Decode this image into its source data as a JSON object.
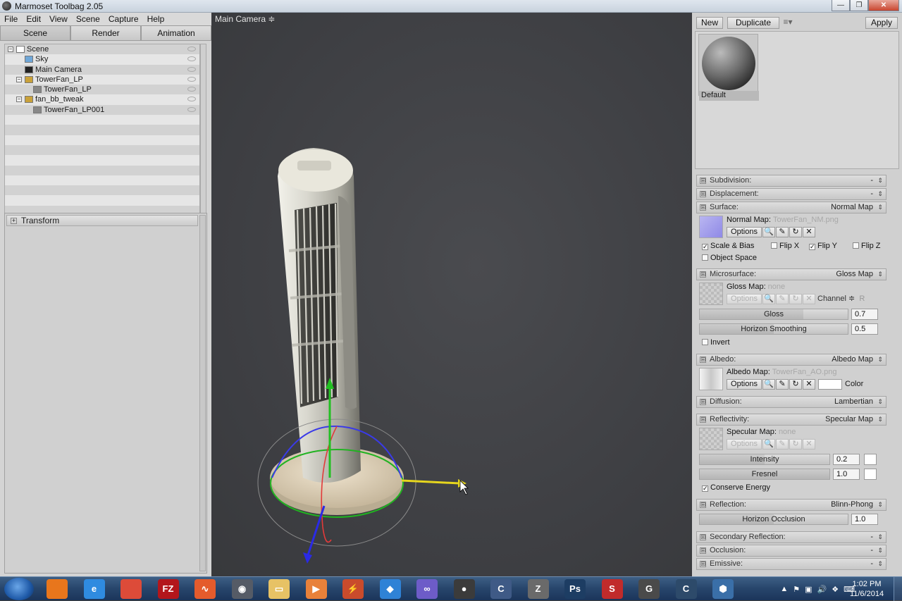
{
  "window": {
    "title": "Marmoset Toolbag 2.05",
    "minimize": "—",
    "maximize": "❐",
    "close": "✕"
  },
  "menu": [
    "File",
    "Edit",
    "View",
    "Scene",
    "Capture",
    "Help"
  ],
  "left_tabs": [
    "Scene",
    "Render",
    "Animation"
  ],
  "scene_tree": [
    {
      "label": "Scene",
      "indent": 0,
      "icon": "scene-icon",
      "expander": "−"
    },
    {
      "label": "Sky",
      "indent": 1,
      "icon": "sky-icon"
    },
    {
      "label": "Main Camera",
      "indent": 1,
      "icon": "camera-icon"
    },
    {
      "label": "TowerFan_LP",
      "indent": 1,
      "icon": "transform-icon",
      "expander": "−"
    },
    {
      "label": "TowerFan_LP",
      "indent": 2,
      "icon": "mesh-icon"
    },
    {
      "label": "fan_bb_tweak",
      "indent": 1,
      "icon": "transform-icon",
      "expander": "−"
    },
    {
      "label": "TowerFan_LP001",
      "indent": 2,
      "icon": "mesh-icon"
    }
  ],
  "transform": {
    "label": "Transform",
    "expander": "+"
  },
  "viewport": {
    "camera_label": "Main Camera ≑"
  },
  "material_bar": {
    "new": "New",
    "duplicate": "Duplicate",
    "menu": "≡▾",
    "apply": "Apply"
  },
  "material": {
    "name": "Default"
  },
  "sections": {
    "subdivision": {
      "name": "Subdivision:",
      "value": "-"
    },
    "displacement": {
      "name": "Displacement:",
      "value": "-"
    },
    "surface": {
      "name": "Surface:",
      "value": "Normal Map"
    },
    "microsurface": {
      "name": "Microsurface:",
      "value": "Gloss Map"
    },
    "albedo": {
      "name": "Albedo:",
      "value": "Albedo Map"
    },
    "diffusion": {
      "name": "Diffusion:",
      "value": "Lambertian"
    },
    "reflectivity": {
      "name": "Reflectivity:",
      "value": "Specular Map"
    },
    "reflection": {
      "name": "Reflection:",
      "value": "Blinn-Phong"
    },
    "secondary_reflection": {
      "name": "Secondary Reflection:",
      "value": "-"
    },
    "occlusion": {
      "name": "Occlusion:",
      "value": "-"
    },
    "emissive": {
      "name": "Emissive:",
      "value": "-"
    }
  },
  "section_plus": "⊞",
  "section_arrow": "⇕",
  "surface": {
    "map_label": "Normal Map:",
    "map_file": "TowerFan_NM.png",
    "options": "Options",
    "scale_bias": "Scale & Bias",
    "flip_x": "Flip X",
    "flip_y": "Flip Y",
    "flip_z": "Flip Z",
    "object_space": "Object Space"
  },
  "microsurface": {
    "map_label": "Gloss Map:",
    "map_file": "none",
    "options": "Options",
    "channel_label": "Channel ≑",
    "channel_value": "R",
    "gloss_label": "Gloss",
    "gloss_value": "0.7",
    "gloss_fraction": 0.7,
    "horizon_label": "Horizon Smoothing",
    "horizon_value": "0.5",
    "horizon_fraction": 0.5,
    "invert": "Invert"
  },
  "albedo": {
    "map_label": "Albedo Map:",
    "map_file": "TowerFan_AO.png",
    "options": "Options",
    "color_label": "Color",
    "color_hex": "#ffffff"
  },
  "reflectivity": {
    "map_label": "Specular Map:",
    "map_file": "none",
    "options": "Options",
    "intensity_label": "Intensity",
    "intensity_value": "0.2",
    "intensity_fraction": 0.5,
    "fresnel_label": "Fresnel",
    "fresnel_value": "1.0",
    "fresnel_fraction": 1.0,
    "conserve_energy": "Conserve Energy"
  },
  "reflection": {
    "occlusion_label": "Horizon Occlusion",
    "occlusion_value": "1.0",
    "occlusion_fraction": 0.5
  },
  "glyphs": {
    "check": "✓",
    "search": "🔍",
    "pencil": "✎",
    "reload": "↻",
    "clear": "✕"
  },
  "taskbar": {
    "apps": [
      {
        "name": "firefox-icon",
        "glyph": "",
        "color": "#e8761c"
      },
      {
        "name": "internet-explorer-icon",
        "glyph": "e",
        "color": "#2f8be0"
      },
      {
        "name": "chrome-icon",
        "glyph": "",
        "color": "#dd4b39"
      },
      {
        "name": "filezilla-icon",
        "glyph": "FZ",
        "color": "#b3161b"
      },
      {
        "name": "app-swirl-icon",
        "glyph": "∿",
        "color": "#e45b2c"
      },
      {
        "name": "marmoset-icon",
        "glyph": "◉",
        "color": "#555b66"
      },
      {
        "name": "explorer-folder-icon",
        "glyph": "▭",
        "color": "#e7c265"
      },
      {
        "name": "media-player-icon",
        "glyph": "▶",
        "color": "#e8813a"
      },
      {
        "name": "xsi-icon",
        "glyph": "⚡",
        "color": "#c94b2c"
      },
      {
        "name": "dropbox-icon",
        "glyph": "◆",
        "color": "#2f82d6"
      },
      {
        "name": "app-purple-icon",
        "glyph": "∞",
        "color": "#6d5cc8"
      },
      {
        "name": "marmoset-active-icon",
        "glyph": "●",
        "color": "#3b3b3b"
      },
      {
        "name": "app-c-icon",
        "glyph": "C",
        "color": "#3f5a86"
      },
      {
        "name": "zbrush-icon",
        "glyph": "Z",
        "color": "#6a6a6a"
      },
      {
        "name": "photoshop-icon",
        "glyph": "Ps",
        "color": "#1d3d63"
      },
      {
        "name": "substance-icon",
        "glyph": "S",
        "color": "#c12b2b"
      },
      {
        "name": "app-gear-icon",
        "glyph": "G",
        "color": "#4a4a4a"
      },
      {
        "name": "app-c2-icon",
        "glyph": "C",
        "color": "#2d4a6a"
      },
      {
        "name": "app-circle-icon",
        "glyph": "⬢",
        "color": "#3a6fa8"
      }
    ],
    "tray_up": "▲",
    "tray_flag": "⚑",
    "tray_net": "▣",
    "tray_vol": "🔊",
    "tray_drop": "❖",
    "tray_kb": "⌨",
    "time": "1:02 PM",
    "date": "11/6/2014"
  }
}
